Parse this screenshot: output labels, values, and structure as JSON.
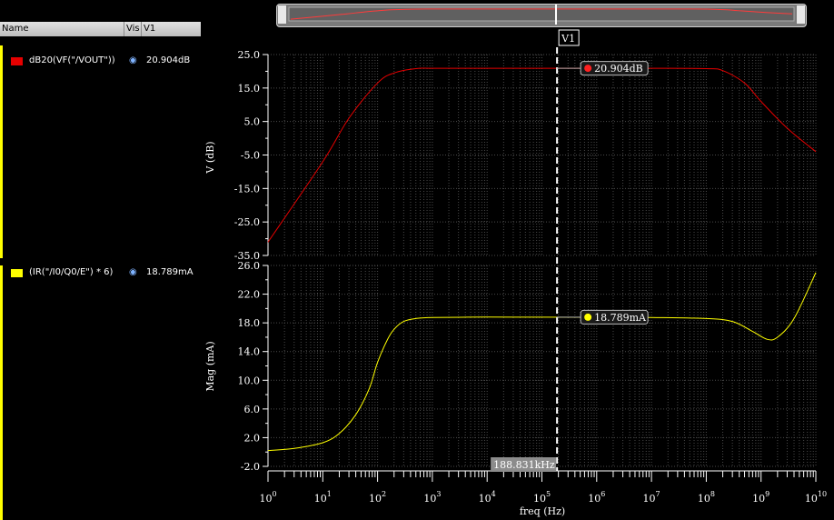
{
  "legend": {
    "header": {
      "name": "Name",
      "vis": "Vis",
      "v1": "V1"
    },
    "entries": [
      {
        "swatch": "#e60000",
        "name": "dB20(VF(\"/VOUT\"))",
        "icon": "eye-icon",
        "value": "20.904dB"
      },
      {
        "swatch": "#ffff00",
        "name": "(IR(\"/I0/Q0/E\") * 6)",
        "icon": "eye-icon",
        "value": "18.789mA"
      }
    ]
  },
  "marker": {
    "name": "V1",
    "x_label": "188.831kHz",
    "x_value": 188831,
    "top_label": "20.904dB",
    "bottom_label": "18.789mA"
  },
  "chart_data": [
    {
      "type": "line",
      "xscale": "log",
      "xlim": [
        1,
        10000000000
      ],
      "ylabel": "V (dB)",
      "ylim": [
        -35,
        25
      ],
      "yticks": [
        "25.0",
        "15.0",
        "5.0",
        "-5.0",
        "-15.0",
        "-25.0",
        "-35.0"
      ],
      "grid": true,
      "series": [
        {
          "name": "dB20(VF(\"/VOUT\"))",
          "color": "#e60000",
          "x": [
            1,
            10,
            30,
            100,
            200,
            500,
            1000,
            10000,
            100000,
            1000000,
            10000000,
            100000000,
            200000000,
            500000000,
            1000000000,
            3000000000,
            10000000000
          ],
          "y": [
            -31,
            -7,
            6,
            16.5,
            19.5,
            20.8,
            20.9,
            20.9,
            20.9,
            20.9,
            20.9,
            20.8,
            20.2,
            16.5,
            11,
            3,
            -4
          ]
        }
      ]
    },
    {
      "type": "line",
      "xscale": "log",
      "xlim": [
        1,
        10000000000
      ],
      "xlabel": "freq (Hz)",
      "ylabel": "Mag (mA)",
      "ylim": [
        -2,
        26
      ],
      "yticks": [
        "26.0",
        "22.0",
        "18.0",
        "14.0",
        "10.0",
        "6.0",
        "2.0",
        "-2.0"
      ],
      "grid": true,
      "series": [
        {
          "name": "(IR(\"/I0/Q0/E\") * 6)",
          "color": "#ffff00",
          "x": [
            1,
            3,
            10,
            20,
            40,
            70,
            100,
            150,
            200,
            300,
            500,
            1000,
            10000,
            100000,
            1000000,
            10000000,
            100000000,
            300000000,
            700000000,
            1300000000,
            2000000000,
            4000000000,
            10000000000
          ],
          "y": [
            0.2,
            0.5,
            1.3,
            2.6,
            5.2,
            8.8,
            12.5,
            15.6,
            17.1,
            18.2,
            18.6,
            18.75,
            18.8,
            18.79,
            18.78,
            18.75,
            18.6,
            18.2,
            16.8,
            15.7,
            16.0,
            18.6,
            25.0
          ]
        }
      ]
    }
  ]
}
